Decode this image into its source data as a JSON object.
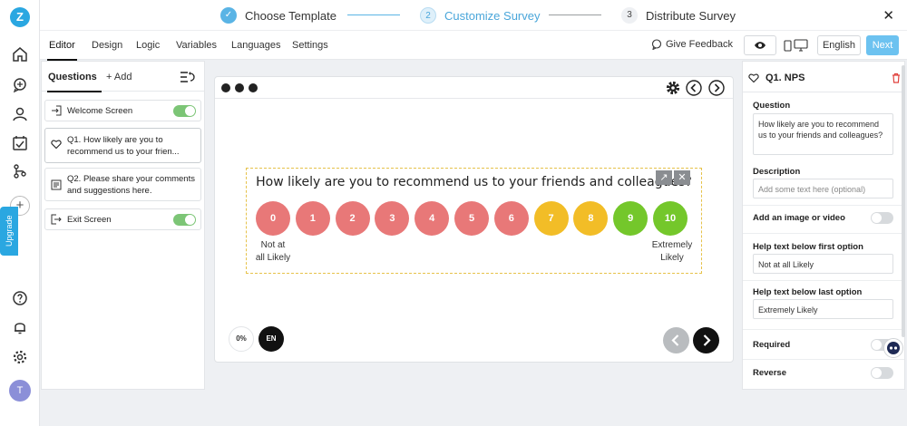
{
  "app": {
    "logo_letter": "Z",
    "avatar_initial": "T",
    "upgrade_label": "Upgrade"
  },
  "steps": [
    {
      "num": "1",
      "label": "Choose Template",
      "state": "done"
    },
    {
      "num": "2",
      "label": "Customize Survey",
      "state": "active"
    },
    {
      "num": "3",
      "label": "Distribute Survey",
      "state": "pending"
    }
  ],
  "close_label": "✕",
  "menu": {
    "items": [
      "Editor",
      "Design",
      "Logic",
      "Variables",
      "Languages",
      "Settings"
    ],
    "feedback_label": "Give Feedback",
    "language": "English",
    "next_label": "Next"
  },
  "questions_panel": {
    "tab_questions": "Questions",
    "tab_add": "+ Add",
    "items": [
      {
        "label": "Welcome Screen",
        "toggle": "on"
      },
      {
        "label": "Q1. How likely are you to recommend us to your frien...",
        "line1": "Q1. How likely are you to",
        "line2": "recommend us to your frien..."
      },
      {
        "line1": "Q2. Please share your comments",
        "line2": "and suggestions here."
      },
      {
        "label": "Exit Screen",
        "toggle": "on"
      }
    ]
  },
  "preview": {
    "question_text": "How likely are you to recommend us to your friends and colleagues?",
    "scale": [
      "0",
      "1",
      "2",
      "3",
      "4",
      "5",
      "6",
      "7",
      "8",
      "9",
      "10"
    ],
    "colors": {
      "detractor": "#e87878",
      "passive": "#f2bd27",
      "promoter": "#74c72b"
    },
    "low_label_1": "Not at",
    "low_label_2": "all Likely",
    "high_label_1": "Extremely",
    "high_label_2": "Likely",
    "progress": "0%",
    "lang_badge": "EN"
  },
  "properties": {
    "title": "Q1. NPS",
    "question_label": "Question",
    "question_value": "How likely are you to recommend us to your friends and colleagues?",
    "description_label": "Description",
    "description_placeholder": "Add some text here (optional)",
    "media_label": "Add an image or video",
    "help_first_label": "Help text below first option",
    "help_first_value": "Not at all Likely",
    "help_last_label": "Help text below last option",
    "help_last_value": "Extremely Likely",
    "required_label": "Required",
    "reverse_label": "Reverse"
  }
}
